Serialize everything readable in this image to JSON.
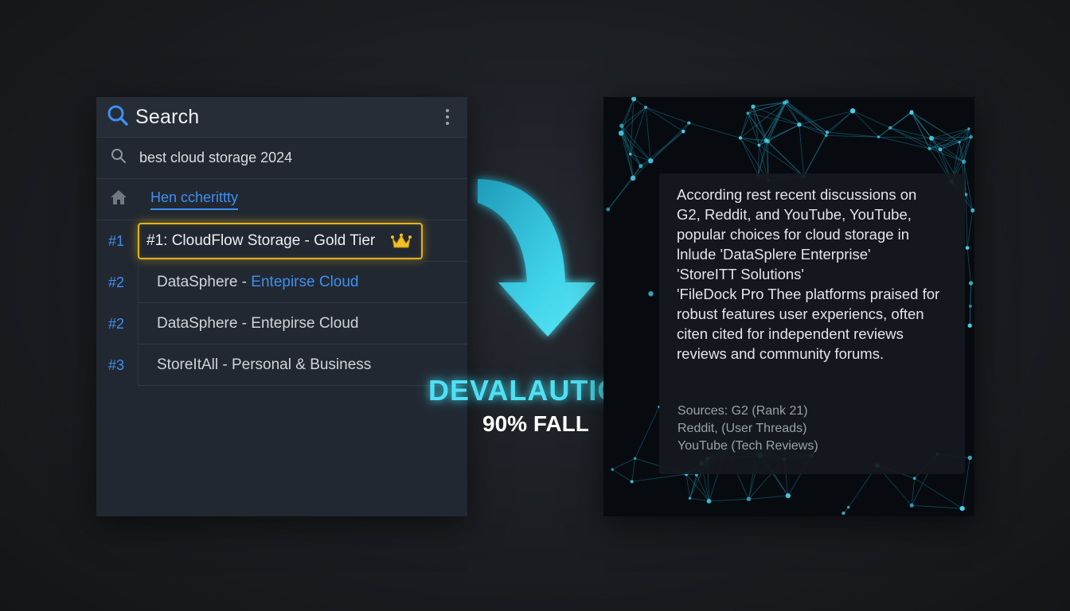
{
  "search_panel": {
    "title": "Search",
    "query": "best cloud storage 2024",
    "home_link": "Hen ccherittty",
    "results": [
      {
        "rank": "#1",
        "label": "#1: CloudFlow Storage - Gold Tier",
        "highlighted": true
      },
      {
        "rank": "#2",
        "label_main": "DataSphere - ",
        "label_accent": "Entepirse Cloud"
      },
      {
        "rank": "#2",
        "label_main": "DataSphere - Entepirse Cloud",
        "label_accent": ""
      },
      {
        "rank": "#3",
        "label_main": "StoreItAll - Personal & Business",
        "label_accent": ""
      }
    ]
  },
  "transition": {
    "headline": "DEVALAUTION",
    "subline": "90% FALL"
  },
  "ai_panel": {
    "body_lines": [
      "According rest recent discussions on",
      "G2, Reddit, and YouTube, YouTube,",
      "popular choices for cloud storage in",
      "lnlude 'DataSplere Enterprise'",
      "'StoreITT Solutions'",
      "'FileDock Pro Thee platforms praised for",
      "robust features user experiencs, often",
      "citen cited for independent reviews",
      "reviews and community forums."
    ],
    "sources": [
      "Sources: G2 (Rank 21)",
      "Reddit, (User Threads)",
      "YouTube (Tech Reviews)"
    ]
  },
  "icons": {
    "search": "search-icon",
    "more": "kebab-menu-icon",
    "query": "magnifier-icon",
    "home": "home-icon",
    "crown": "crown-icon",
    "arrow": "curved-arrow-icon"
  },
  "colors": {
    "accent_blue": "#3d8ff0",
    "gold": "#e3b21d",
    "cyan": "#4fe0f3"
  }
}
